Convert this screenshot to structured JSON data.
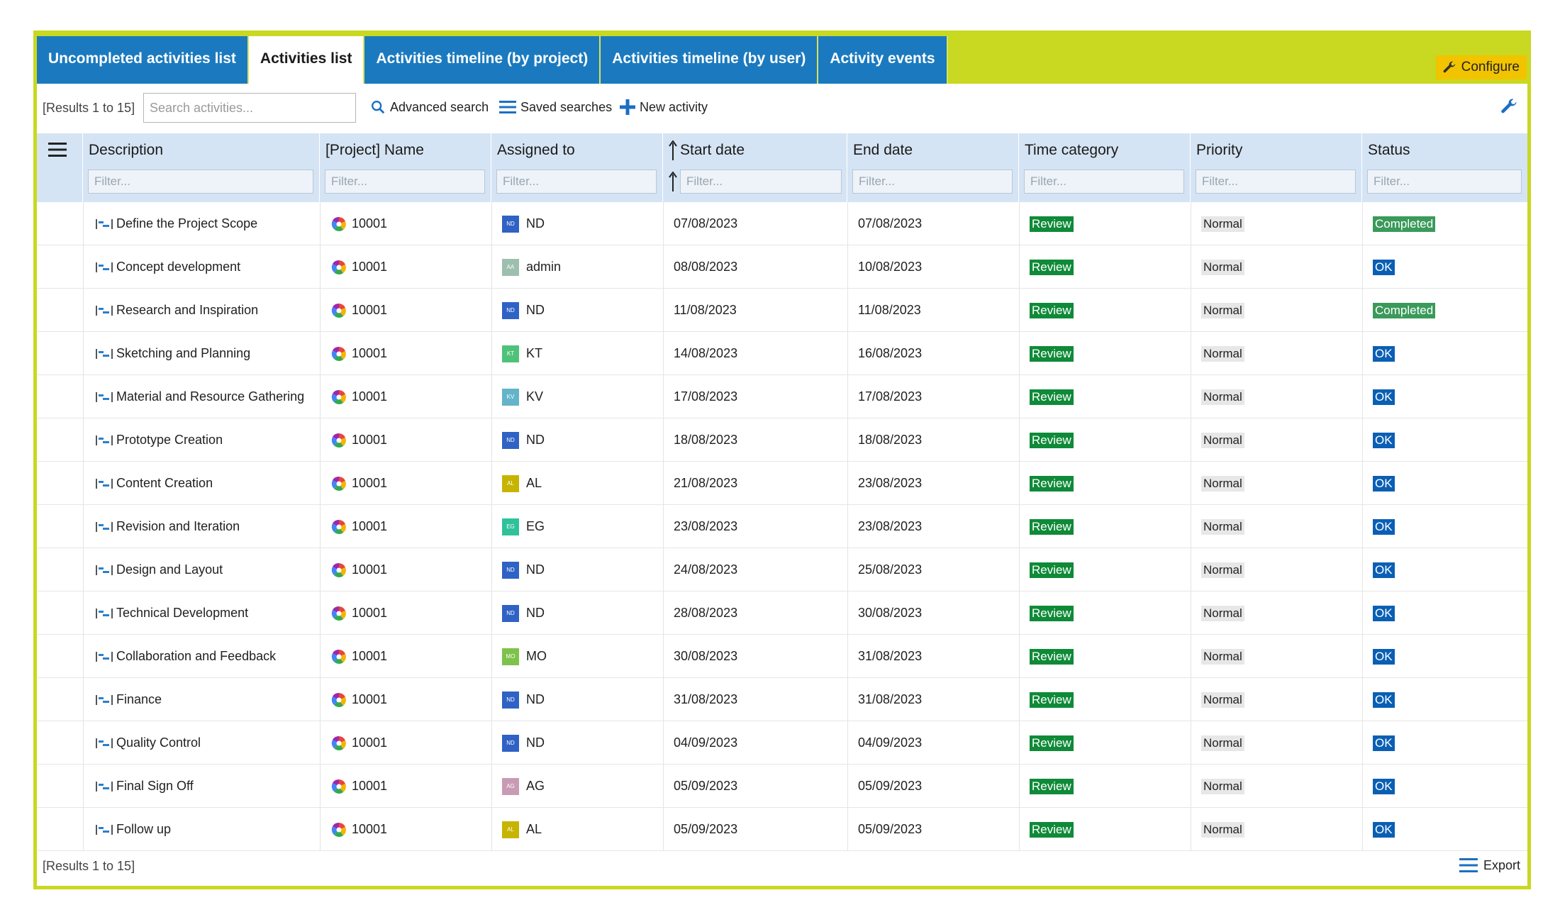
{
  "tabs": [
    {
      "label": "Uncompleted activities list",
      "active": false
    },
    {
      "label": "Activities list",
      "active": true
    },
    {
      "label": "Activities timeline (by project)",
      "active": false
    },
    {
      "label": "Activities timeline (by user)",
      "active": false
    },
    {
      "label": "Activity events",
      "active": false
    }
  ],
  "configure_label": "Configure",
  "toolbar": {
    "results": "[Results 1 to 15]",
    "search_placeholder": "Search activities...",
    "advanced_search": "Advanced search",
    "saved_searches": "Saved searches",
    "new_activity": "New activity"
  },
  "columns": [
    {
      "label": "Description"
    },
    {
      "label": "[Project] Name"
    },
    {
      "label": "Assigned to"
    },
    {
      "label": "Start date",
      "sorted": true
    },
    {
      "label": "End date"
    },
    {
      "label": "Time category"
    },
    {
      "label": "Priority"
    },
    {
      "label": "Status"
    }
  ],
  "filter_placeholder": "Filter...",
  "rows": [
    {
      "description": "Define the Project Scope",
      "project": "10001",
      "assignee": "ND",
      "avatar": "ND",
      "avatar_color": "#2f62c4",
      "start": "07/08/2023",
      "end": "07/08/2023",
      "time_category": "Review",
      "priority": "Normal",
      "status": "Completed"
    },
    {
      "description": "Concept development",
      "project": "10001",
      "assignee": "admin",
      "avatar": "AA",
      "avatar_color": "#9dbfae",
      "start": "08/08/2023",
      "end": "10/08/2023",
      "time_category": "Review",
      "priority": "Normal",
      "status": "OK"
    },
    {
      "description": "Research and Inspiration",
      "project": "10001",
      "assignee": "ND",
      "avatar": "ND",
      "avatar_color": "#2f62c4",
      "start": "11/08/2023",
      "end": "11/08/2023",
      "time_category": "Review",
      "priority": "Normal",
      "status": "Completed"
    },
    {
      "description": "Sketching and Planning",
      "project": "10001",
      "assignee": "KT",
      "avatar": "KT",
      "avatar_color": "#4fc27a",
      "start": "14/08/2023",
      "end": "16/08/2023",
      "time_category": "Review",
      "priority": "Normal",
      "status": "OK"
    },
    {
      "description": "Material and Resource Gathering",
      "project": "10001",
      "assignee": "KV",
      "avatar": "KV",
      "avatar_color": "#63b4c9",
      "start": "17/08/2023",
      "end": "17/08/2023",
      "time_category": "Review",
      "priority": "Normal",
      "status": "OK"
    },
    {
      "description": "Prototype Creation",
      "project": "10001",
      "assignee": "ND",
      "avatar": "ND",
      "avatar_color": "#2f62c4",
      "start": "18/08/2023",
      "end": "18/08/2023",
      "time_category": "Review",
      "priority": "Normal",
      "status": "OK"
    },
    {
      "description": "Content Creation",
      "project": "10001",
      "assignee": "AL",
      "avatar": "AL",
      "avatar_color": "#c7b400",
      "start": "21/08/2023",
      "end": "23/08/2023",
      "time_category": "Review",
      "priority": "Normal",
      "status": "OK"
    },
    {
      "description": "Revision and Iteration",
      "project": "10001",
      "assignee": "EG",
      "avatar": "EG",
      "avatar_color": "#2fc29a",
      "start": "23/08/2023",
      "end": "23/08/2023",
      "time_category": "Review",
      "priority": "Normal",
      "status": "OK"
    },
    {
      "description": "Design and Layout",
      "project": "10001",
      "assignee": "ND",
      "avatar": "ND",
      "avatar_color": "#2f62c4",
      "start": "24/08/2023",
      "end": "25/08/2023",
      "time_category": "Review",
      "priority": "Normal",
      "status": "OK"
    },
    {
      "description": "Technical Development",
      "project": "10001",
      "assignee": "ND",
      "avatar": "ND",
      "avatar_color": "#2f62c4",
      "start": "28/08/2023",
      "end": "30/08/2023",
      "time_category": "Review",
      "priority": "Normal",
      "status": "OK"
    },
    {
      "description": "Collaboration and Feedback",
      "project": "10001",
      "assignee": "MO",
      "avatar": "MO",
      "avatar_color": "#7dc24a",
      "start": "30/08/2023",
      "end": "31/08/2023",
      "time_category": "Review",
      "priority": "Normal",
      "status": "OK"
    },
    {
      "description": "Finance",
      "project": "10001",
      "assignee": "ND",
      "avatar": "ND",
      "avatar_color": "#2f62c4",
      "start": "31/08/2023",
      "end": "31/08/2023",
      "time_category": "Review",
      "priority": "Normal",
      "status": "OK"
    },
    {
      "description": "Quality Control",
      "project": "10001",
      "assignee": "ND",
      "avatar": "ND",
      "avatar_color": "#2f62c4",
      "start": "04/09/2023",
      "end": "04/09/2023",
      "time_category": "Review",
      "priority": "Normal",
      "status": "OK"
    },
    {
      "description": "Final Sign Off",
      "project": "10001",
      "assignee": "AG",
      "avatar": "AG",
      "avatar_color": "#c99ab4",
      "start": "05/09/2023",
      "end": "05/09/2023",
      "time_category": "Review",
      "priority": "Normal",
      "status": "OK"
    },
    {
      "description": "Follow up",
      "project": "10001",
      "assignee": "AL",
      "avatar": "AL",
      "avatar_color": "#c7b400",
      "start": "05/09/2023",
      "end": "05/09/2023",
      "time_category": "Review",
      "priority": "Normal",
      "status": "OK"
    }
  ],
  "footer": {
    "results": "[Results 1 to 15]",
    "export": "Export"
  },
  "colors": {
    "frame": "#c9d821",
    "tab": "#1b7abf",
    "header": "#d5e4f4",
    "review": "#0f8a38",
    "ok": "#0a5fb4",
    "completed": "#3a9a5a",
    "configure": "#f2c400"
  }
}
